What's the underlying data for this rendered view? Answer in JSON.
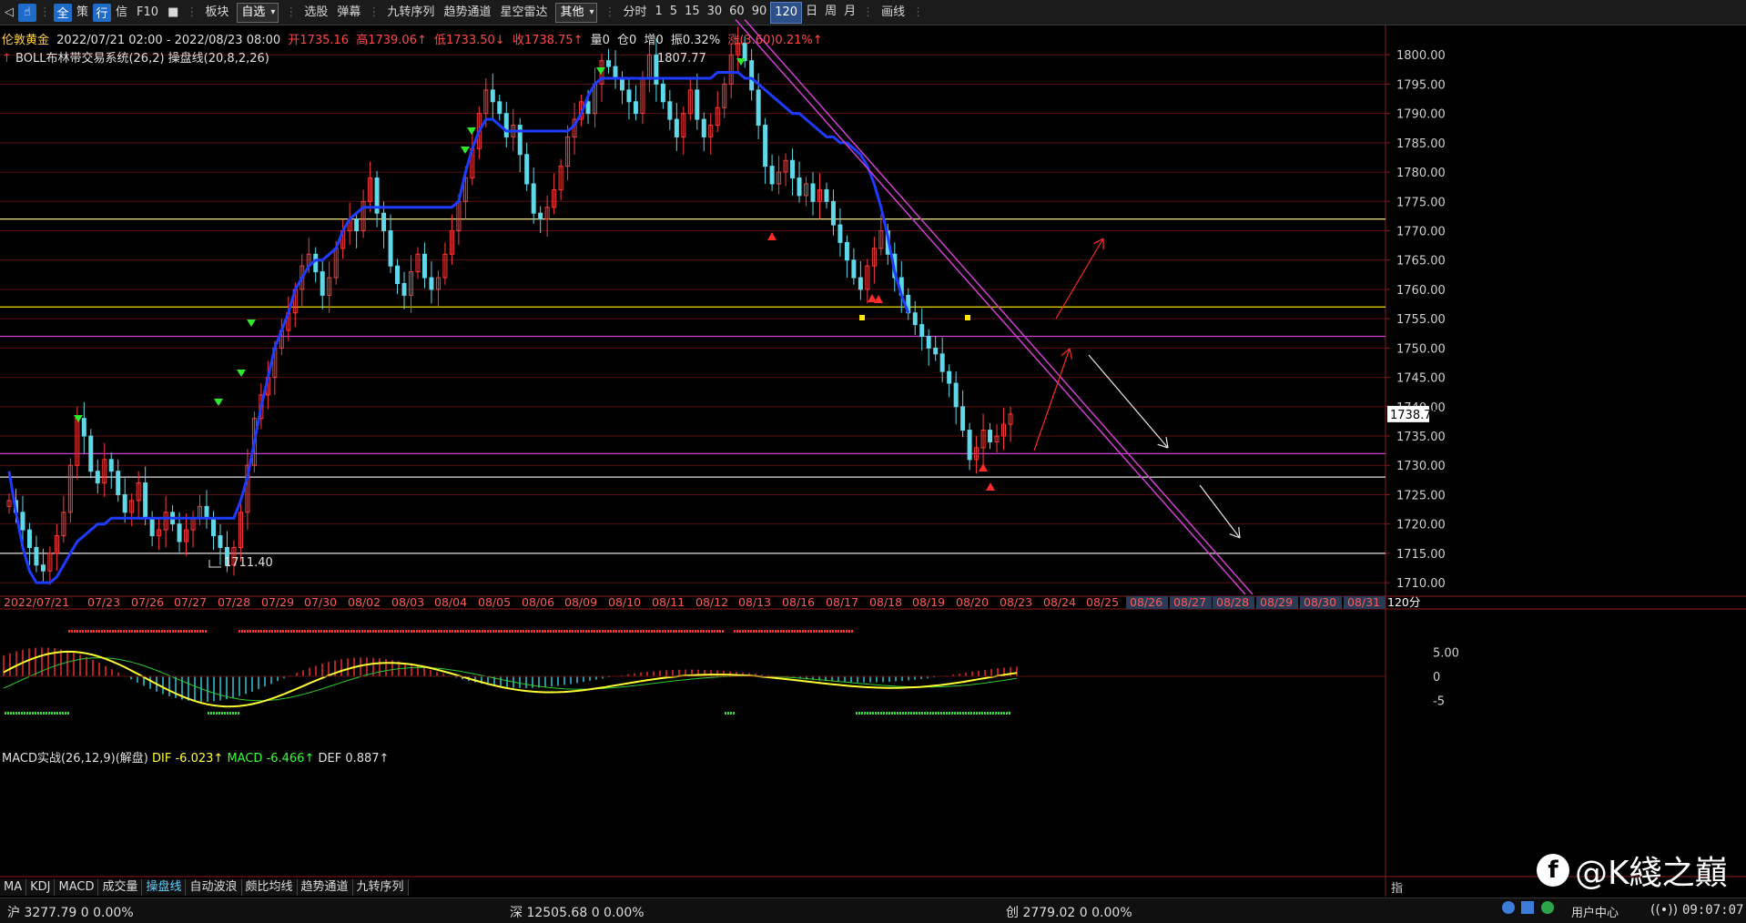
{
  "toolbar": {
    "nav": [
      "◁",
      "☝",
      "⋮"
    ],
    "items_a": [
      "全",
      "策",
      "行",
      "信",
      "F10",
      "■"
    ],
    "label_block": "板块",
    "select_watch": "自选",
    "items_b": [
      "选股",
      "弹幕"
    ],
    "items_c": [
      "九转序列",
      "趋势通道",
      "星空雷达"
    ],
    "select_other": "其他",
    "label_timeshare": "分时",
    "periods": [
      "1",
      "5",
      "15",
      "30",
      "60",
      "90",
      "120",
      "日",
      "周",
      "月"
    ],
    "active_period": "120",
    "label_draw": "画线"
  },
  "info": {
    "name": "伦敦黄金",
    "range": "2022/07/21 02:00 - 2022/08/23 08:00",
    "open": "开1735.16",
    "high": "高1739.06↑",
    "low": "低1733.50↓",
    "close": "收1738.75↑",
    "vol": "量0",
    "pos": "仓0",
    "add": "增0",
    "amp": "振0.32%",
    "chg": "涨(3.60)0.21%↑",
    "boll": "BOLL布林带交易系统(26,2)  操盘线(20,8,2,26)"
  },
  "price_axis": {
    "ticks": [
      "1800.00",
      "1795.00",
      "1790.00",
      "1785.00",
      "1780.00",
      "1775.00",
      "1770.00",
      "1765.00",
      "1760.00",
      "1755.00",
      "1750.00",
      "1745.00",
      "1740.00",
      "1735.00",
      "1730.00",
      "1725.00",
      "1720.00",
      "1715.00",
      "1710.00"
    ],
    "current": "1738.75"
  },
  "annotations": {
    "high": "1807.77",
    "low": "1711.40"
  },
  "date_axis": {
    "dates": [
      "2022/07/21",
      "07/23",
      "07/26",
      "07/27",
      "07/28",
      "07/29",
      "07/30",
      "08/02",
      "08/03",
      "08/04",
      "08/05",
      "08/06",
      "08/09",
      "08/10",
      "08/11",
      "08/12",
      "08/13",
      "08/16",
      "08/17",
      "08/18",
      "08/19",
      "08/20",
      "08/23",
      "08/24",
      "08/25",
      "08/26",
      "08/27",
      "08/28",
      "08/29",
      "08/30",
      "08/31"
    ],
    "period": "120分"
  },
  "macd": {
    "title": "MACD实战(26,12,9)(解盘)",
    "dif": "DIF -6.023↑",
    "macd": "MACD -6.466↑",
    "def": "DEF 0.887↑",
    "ticks": [
      "5.00",
      "0",
      "-5"
    ]
  },
  "bottom_tabs": [
    "MA",
    "KDJ",
    "MACD",
    "成交量",
    "操盘线",
    "自动波浪",
    "颇比均线",
    "趋势通道",
    "九转序列"
  ],
  "active_tab": "操盘线",
  "indicator_label": "指",
  "status": {
    "sh": "沪  3277.79  0  0.00%",
    "sz": "深  12505.68  0  0.00%",
    "cy": "创  2779.02  0  0.00%",
    "user": "用户中心",
    "time": "09:07:07"
  },
  "watermark": {
    "text": "@K綫之巔"
  },
  "chart_data": {
    "type": "candlestick",
    "title": "伦敦黄金",
    "ylim": [
      1708,
      1805
    ],
    "levels": [
      1772,
      1757,
      1752,
      1732,
      1728,
      1715
    ],
    "high_mark": 1807.77,
    "low_mark": 1711.4,
    "close_series": [
      1724,
      1722,
      1719,
      1716,
      1713,
      1712,
      1715,
      1718,
      1722,
      1730,
      1738,
      1735,
      1729,
      1727,
      1731,
      1729,
      1725,
      1722,
      1724,
      1727,
      1721,
      1718,
      1719,
      1722,
      1720,
      1717,
      1719,
      1721,
      1723,
      1721,
      1718,
      1716,
      1713,
      1716,
      1722,
      1730,
      1738,
      1742,
      1745,
      1750,
      1753,
      1756,
      1760,
      1764,
      1766,
      1763,
      1759,
      1762,
      1767,
      1770,
      1772,
      1770,
      1775,
      1779,
      1773,
      1770,
      1764,
      1761,
      1759,
      1763,
      1766,
      1762,
      1760,
      1762,
      1766,
      1770,
      1775,
      1779,
      1784,
      1790,
      1794,
      1792,
      1790,
      1786,
      1788,
      1783,
      1778,
      1773,
      1772,
      1774,
      1777,
      1781,
      1786,
      1789,
      1792,
      1790,
      1795,
      1799,
      1798,
      1796,
      1794,
      1792,
      1790,
      1796,
      1800,
      1795,
      1792,
      1789,
      1786,
      1790,
      1794,
      1789,
      1786,
      1788,
      1791,
      1795,
      1800,
      1802,
      1799,
      1794,
      1788,
      1781,
      1778,
      1780,
      1782,
      1779,
      1776,
      1778,
      1775,
      1777,
      1775,
      1771,
      1768,
      1765,
      1762,
      1760,
      1764,
      1767,
      1770,
      1766,
      1762,
      1759,
      1756,
      1754,
      1752,
      1750,
      1749,
      1746,
      1744,
      1740,
      1736,
      1731,
      1733,
      1736,
      1734,
      1735,
      1737,
      1738.75
    ],
    "band_series": [
      1729,
      1722,
      1716,
      1712,
      1710,
      1710,
      1710,
      1711,
      1713,
      1715,
      1717,
      1718,
      1719,
      1720,
      1720,
      1721,
      1721,
      1721,
      1721,
      1721,
      1721,
      1721,
      1721,
      1721,
      1721,
      1721,
      1721,
      1721,
      1721,
      1721,
      1721,
      1721,
      1721,
      1721,
      1724,
      1728,
      1734,
      1740,
      1745,
      1750,
      1753,
      1756,
      1760,
      1762,
      1764,
      1765,
      1765,
      1766,
      1767,
      1770,
      1772,
      1773,
      1774,
      1774,
      1774,
      1774,
      1774,
      1774,
      1774,
      1774,
      1774,
      1774,
      1774,
      1774,
      1774,
      1774,
      1775,
      1780,
      1784,
      1787,
      1789,
      1789,
      1788,
      1787,
      1787,
      1787,
      1787,
      1787,
      1787,
      1787,
      1787,
      1787,
      1787,
      1788,
      1790,
      1793,
      1795,
      1796,
      1796,
      1796,
      1796,
      1796,
      1796,
      1796,
      1796,
      1796,
      1796,
      1796,
      1796,
      1796,
      1796,
      1796,
      1796,
      1796,
      1797,
      1797,
      1797,
      1797,
      1796,
      1796,
      1795,
      1794,
      1793,
      1792,
      1791,
      1790,
      1790,
      1789,
      1788,
      1787,
      1786,
      1786,
      1785,
      1785,
      1784,
      1783,
      1781,
      1778,
      1774,
      1769,
      1763,
      1759,
      1756
    ]
  }
}
